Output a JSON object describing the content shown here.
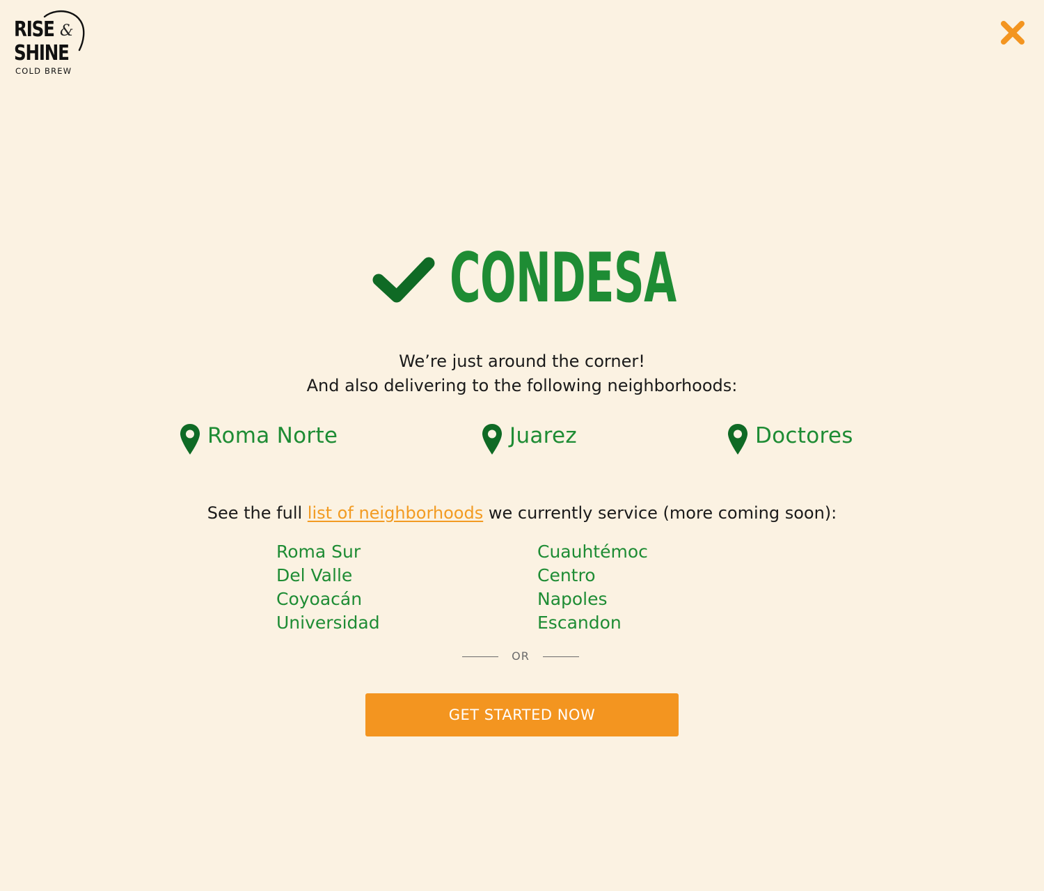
{
  "brand": {
    "name_line1": "RISE",
    "ampersand": "&",
    "name_line2": "SHINE",
    "tagline": "COLD BREW"
  },
  "icons": {
    "close": "close-icon",
    "check": "check-icon",
    "pin": "map-pin-icon"
  },
  "colors": {
    "background": "#fbf2e2",
    "green": "#1e8c34",
    "dark_green": "#0f6a25",
    "orange": "#f39520",
    "text": "#1a1a1a"
  },
  "result": {
    "neighborhood": "CONDESA",
    "line1": "We’re just around the corner!",
    "line2": "And also delivering to the following neighborhoods:"
  },
  "nearby": [
    {
      "label": "Roma Norte"
    },
    {
      "label": "Juarez"
    },
    {
      "label": "Doctores"
    }
  ],
  "full_list": {
    "prefix": "See the full ",
    "link_text": "list of neighborhoods",
    "suffix": " we currently service (more coming soon):",
    "column1": [
      "Roma Sur",
      "Del Valle",
      "Coyoacán",
      "Universidad"
    ],
    "column2": [
      "Cuauhtémoc",
      "Centro",
      "Napoles",
      "Escandon"
    ]
  },
  "divider": {
    "text": "OR"
  },
  "cta": {
    "label": "GET STARTED NOW"
  }
}
